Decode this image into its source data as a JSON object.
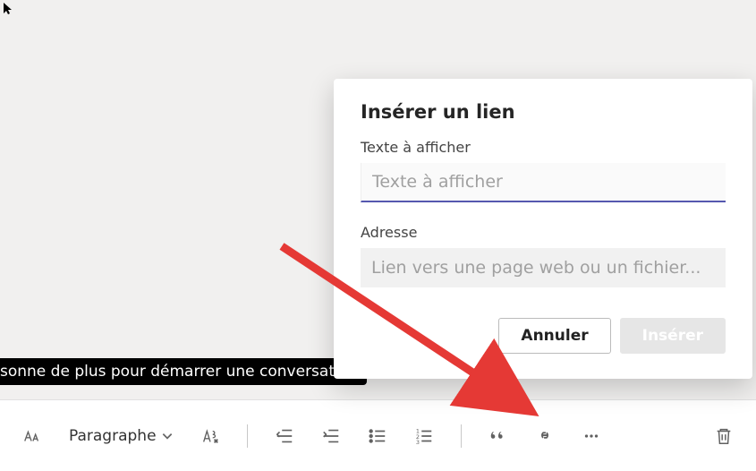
{
  "cursor": "default-cursor",
  "banner": {
    "text": "sonne de plus pour démarrer une conversation"
  },
  "toolbar": {
    "font_size_label": "Font size",
    "paragraph_label": "Paragraphe",
    "clear_format_label": "Clear formatting",
    "outdent_label": "Decrease indent",
    "indent_label": "Increase indent",
    "bullets_label": "Bulleted list",
    "numbers_label": "Numbered list",
    "quote_label": "Quote",
    "link_label": "Insert link",
    "more_label": "More options",
    "delete_label": "Delete"
  },
  "popup": {
    "title": "Insérer un lien",
    "text_label": "Texte à afficher",
    "text_placeholder": "Texte à afficher",
    "address_label": "Adresse",
    "address_placeholder": "Lien vers une page web ou un fichier...",
    "cancel": "Annuler",
    "insert": "Insérer"
  }
}
